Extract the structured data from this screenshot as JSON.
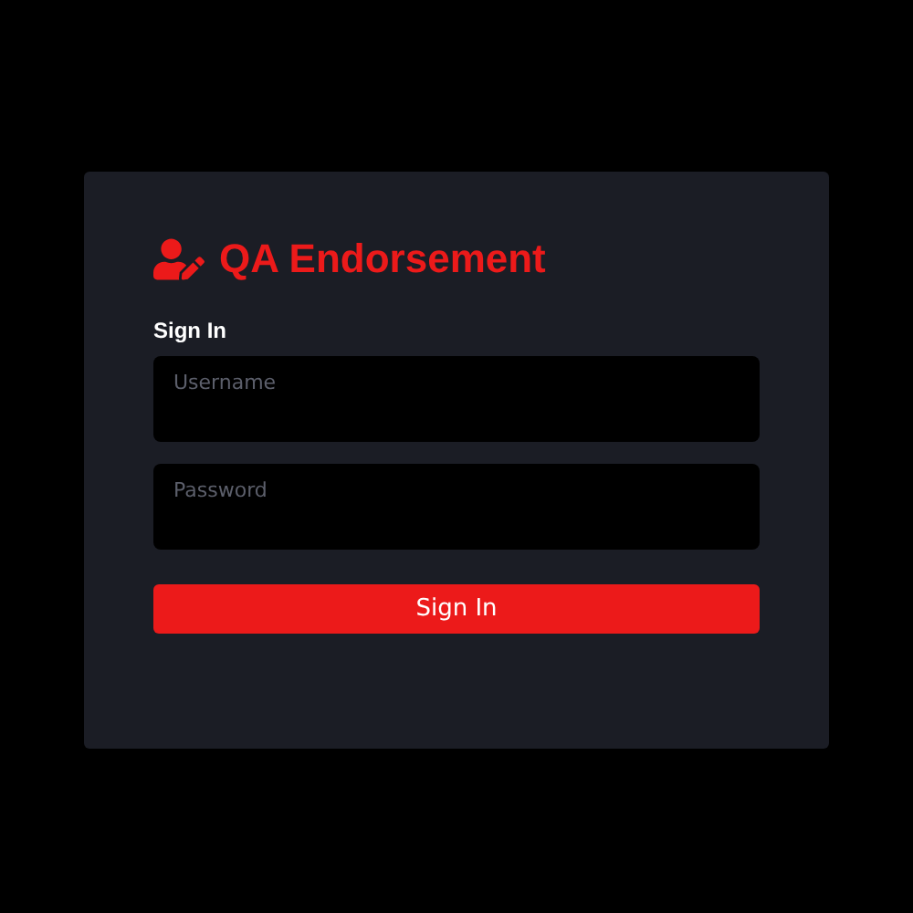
{
  "title": "QA Endorsement",
  "form": {
    "heading": "Sign In",
    "fields": [
      {
        "placeholder": "Username"
      },
      {
        "placeholder": "Password"
      }
    ],
    "submit": "Sign In"
  }
}
